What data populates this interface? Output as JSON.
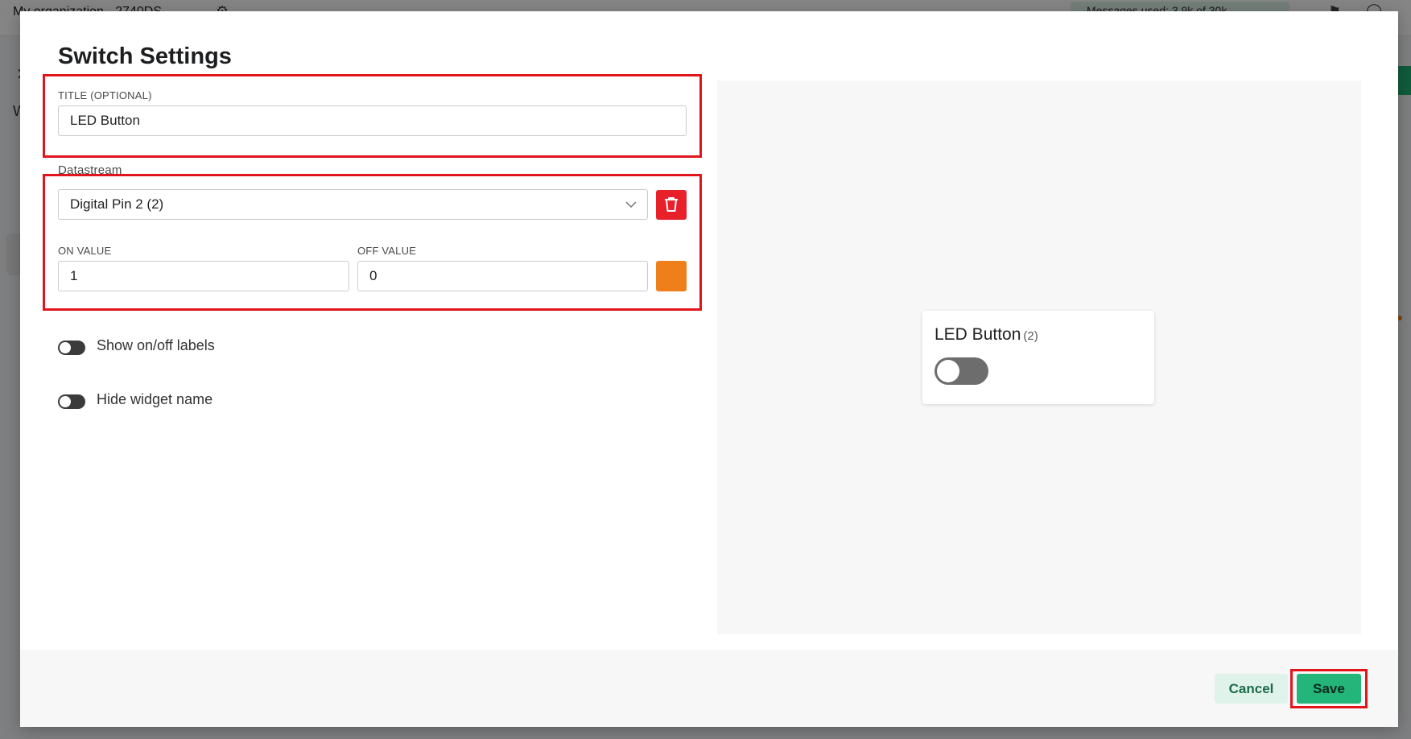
{
  "background": {
    "org_name": "My organization - 2740DS",
    "messages_used": "Messages used: 3.9k of 30k",
    "side_letter": "W"
  },
  "modal": {
    "title": "Switch Settings",
    "title_field": {
      "label": "TITLE (OPTIONAL)",
      "value": "LED Button"
    },
    "datastream": {
      "label": "Datastream",
      "selected": "Digital Pin 2 (2)"
    },
    "on_value": {
      "label": "ON VALUE",
      "value": "1"
    },
    "off_value": {
      "label": "OFF VALUE",
      "value": "0"
    },
    "color": "#ef7f1a",
    "toggles": [
      {
        "label": "Show on/off labels",
        "state": "off"
      },
      {
        "label": "Hide widget name",
        "state": "off"
      }
    ],
    "preview": {
      "widget_name": "LED Button",
      "widget_pin": "(2)",
      "switch_state": "off"
    },
    "footer": {
      "cancel_label": "Cancel",
      "save_label": "Save"
    }
  },
  "colors": {
    "highlight": "#e2141c",
    "delete": "#e8202a",
    "save": "#23b57a",
    "cancel_bg": "#dff3ea"
  }
}
